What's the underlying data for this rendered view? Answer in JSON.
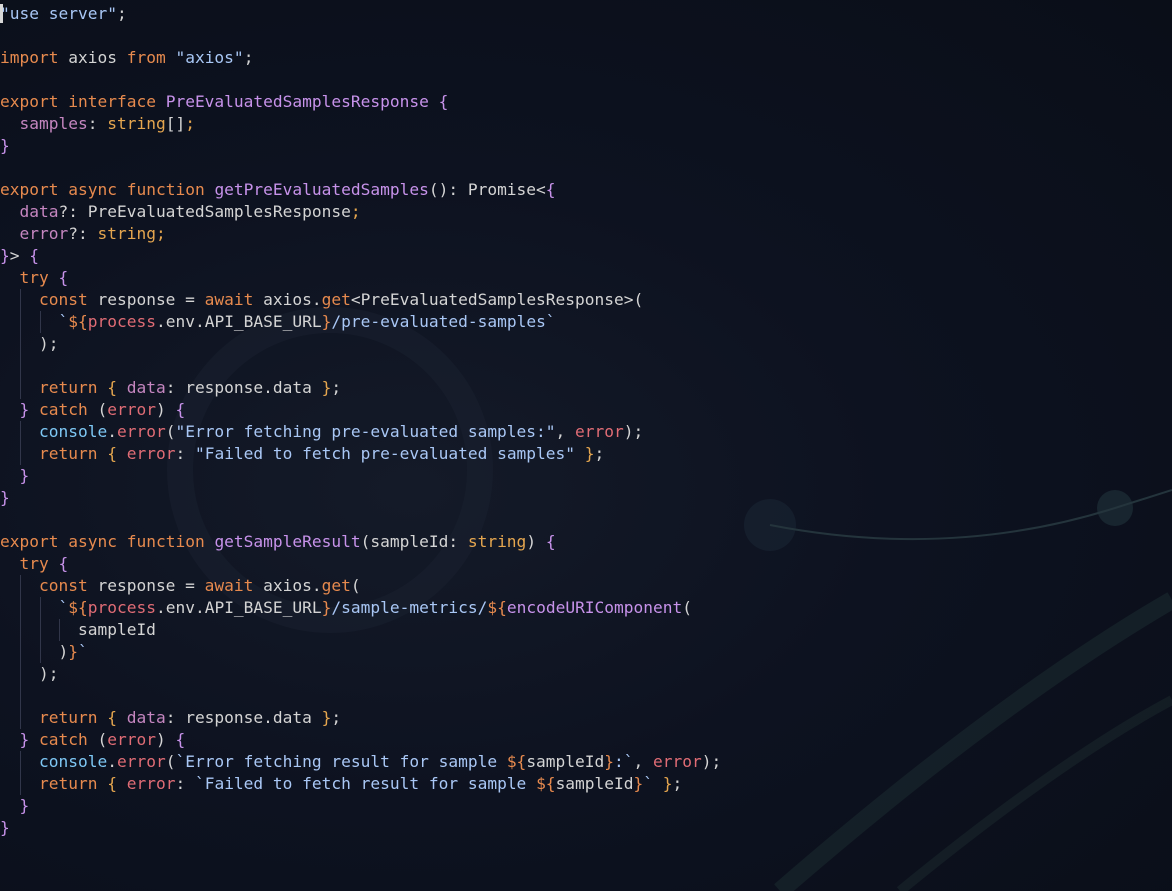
{
  "editor": {
    "language": "typescript",
    "colors": {
      "background": "#0b0f1a",
      "keyword": "#c678dd",
      "control": "#e78a4e",
      "string": "#a9c7f5",
      "type": "#e5a64f",
      "function": "#c792ea",
      "plain": "#cdd6f4"
    },
    "lines": [
      {
        "guides": [],
        "tokens": [
          {
            "c": "str",
            "t": "\"use server\""
          },
          {
            "c": "punc",
            "t": ";"
          }
        ]
      },
      {
        "guides": [],
        "tokens": []
      },
      {
        "guides": [],
        "tokens": [
          {
            "c": "kw",
            "t": "import"
          },
          {
            "c": "punc",
            "t": " axios "
          },
          {
            "c": "kw",
            "t": "from"
          },
          {
            "c": "punc",
            "t": " "
          },
          {
            "c": "str",
            "t": "\"axios\""
          },
          {
            "c": "punc",
            "t": ";"
          }
        ]
      },
      {
        "guides": [],
        "tokens": []
      },
      {
        "guides": [],
        "tokens": [
          {
            "c": "kw",
            "t": "export"
          },
          {
            "c": "punc",
            "t": " "
          },
          {
            "c": "kw",
            "t": "interface"
          },
          {
            "c": "punc",
            "t": " "
          },
          {
            "c": "fn",
            "t": "PreEvaluatedSamplesResponse"
          },
          {
            "c": "punc",
            "t": " "
          },
          {
            "c": "fn",
            "t": "{"
          }
        ]
      },
      {
        "guides": [],
        "tokens": [
          {
            "c": "punc",
            "t": "  "
          },
          {
            "c": "prop",
            "t": "samples"
          },
          {
            "c": "punc",
            "t": ": "
          },
          {
            "c": "ty",
            "t": "string"
          },
          {
            "c": "punc",
            "t": "[]"
          },
          {
            "c": "ty",
            "t": ";"
          }
        ]
      },
      {
        "guides": [],
        "tokens": [
          {
            "c": "fn",
            "t": "}"
          }
        ]
      },
      {
        "guides": [],
        "tokens": []
      },
      {
        "guides": [],
        "tokens": [
          {
            "c": "kw",
            "t": "export"
          },
          {
            "c": "punc",
            "t": " "
          },
          {
            "c": "kw",
            "t": "async"
          },
          {
            "c": "punc",
            "t": " "
          },
          {
            "c": "kw",
            "t": "function"
          },
          {
            "c": "punc",
            "t": " "
          },
          {
            "c": "fn",
            "t": "getPreEvaluatedSamples"
          },
          {
            "c": "punc",
            "t": "(): Promise<"
          },
          {
            "c": "fn",
            "t": "{"
          }
        ]
      },
      {
        "guides": [],
        "tokens": [
          {
            "c": "punc",
            "t": "  "
          },
          {
            "c": "prop",
            "t": "data"
          },
          {
            "c": "punc",
            "t": "?: PreEvaluatedSamplesResponse"
          },
          {
            "c": "ty",
            "t": ";"
          }
        ]
      },
      {
        "guides": [],
        "tokens": [
          {
            "c": "punc",
            "t": "  "
          },
          {
            "c": "prop",
            "t": "error"
          },
          {
            "c": "punc",
            "t": "?: "
          },
          {
            "c": "ty",
            "t": "string"
          },
          {
            "c": "ty",
            "t": ";"
          }
        ]
      },
      {
        "guides": [],
        "tokens": [
          {
            "c": "fn",
            "t": "}"
          },
          {
            "c": "punc",
            "t": "> "
          },
          {
            "c": "fn",
            "t": "{"
          }
        ]
      },
      {
        "guides": [],
        "tokens": [
          {
            "c": "punc",
            "t": "  "
          },
          {
            "c": "kw",
            "t": "try"
          },
          {
            "c": "punc",
            "t": " "
          },
          {
            "c": "fn",
            "t": "{"
          }
        ]
      },
      {
        "guides": [
          2
        ],
        "tokens": [
          {
            "c": "punc",
            "t": "    "
          },
          {
            "c": "kw",
            "t": "const"
          },
          {
            "c": "punc",
            "t": " response = "
          },
          {
            "c": "kw",
            "t": "await"
          },
          {
            "c": "punc",
            "t": " axios."
          },
          {
            "c": "kw",
            "t": "get"
          },
          {
            "c": "punc",
            "t": "<PreEvaluatedSamplesResponse>("
          }
        ]
      },
      {
        "guides": [
          2,
          4
        ],
        "tokens": [
          {
            "c": "punc",
            "t": "      "
          },
          {
            "c": "str",
            "t": "`"
          },
          {
            "c": "kw",
            "t": "${"
          },
          {
            "c": "var",
            "t": "process"
          },
          {
            "c": "punc",
            "t": ".env.API_BASE_URL"
          },
          {
            "c": "kw",
            "t": "}"
          },
          {
            "c": "str",
            "t": "/pre-evaluated-samples`"
          }
        ]
      },
      {
        "guides": [
          2
        ],
        "tokens": [
          {
            "c": "punc",
            "t": "    );"
          }
        ]
      },
      {
        "guides": [
          2
        ],
        "tokens": []
      },
      {
        "guides": [
          2
        ],
        "tokens": [
          {
            "c": "punc",
            "t": "    "
          },
          {
            "c": "kw",
            "t": "return"
          },
          {
            "c": "punc",
            "t": " "
          },
          {
            "c": "ty",
            "t": "{"
          },
          {
            "c": "punc",
            "t": " "
          },
          {
            "c": "prop",
            "t": "data"
          },
          {
            "c": "punc",
            "t": ": response.data "
          },
          {
            "c": "ty",
            "t": "}"
          },
          {
            "c": "punc",
            "t": ";"
          }
        ]
      },
      {
        "guides": [],
        "tokens": [
          {
            "c": "punc",
            "t": "  "
          },
          {
            "c": "fn",
            "t": "}"
          },
          {
            "c": "punc",
            "t": " "
          },
          {
            "c": "kw",
            "t": "catch"
          },
          {
            "c": "punc",
            "t": " ("
          },
          {
            "c": "var",
            "t": "error"
          },
          {
            "c": "punc",
            "t": ") "
          },
          {
            "c": "fn",
            "t": "{"
          }
        ]
      },
      {
        "guides": [
          2
        ],
        "tokens": [
          {
            "c": "punc",
            "t": "    "
          },
          {
            "c": "obj",
            "t": "console"
          },
          {
            "c": "punc",
            "t": "."
          },
          {
            "c": "var",
            "t": "error"
          },
          {
            "c": "punc",
            "t": "("
          },
          {
            "c": "str",
            "t": "\"Error fetching pre-evaluated samples:\""
          },
          {
            "c": "punc",
            "t": ", "
          },
          {
            "c": "var",
            "t": "error"
          },
          {
            "c": "punc",
            "t": ");"
          }
        ]
      },
      {
        "guides": [
          2
        ],
        "tokens": [
          {
            "c": "punc",
            "t": "    "
          },
          {
            "c": "kw",
            "t": "return"
          },
          {
            "c": "punc",
            "t": " "
          },
          {
            "c": "ty",
            "t": "{"
          },
          {
            "c": "punc",
            "t": " "
          },
          {
            "c": "var",
            "t": "error"
          },
          {
            "c": "punc",
            "t": ": "
          },
          {
            "c": "str",
            "t": "\"Failed to fetch pre-evaluated samples\""
          },
          {
            "c": "punc",
            "t": " "
          },
          {
            "c": "ty",
            "t": "}"
          },
          {
            "c": "punc",
            "t": ";"
          }
        ]
      },
      {
        "guides": [],
        "tokens": [
          {
            "c": "punc",
            "t": "  "
          },
          {
            "c": "fn",
            "t": "}"
          }
        ]
      },
      {
        "guides": [],
        "tokens": [
          {
            "c": "fn",
            "t": "}"
          }
        ]
      },
      {
        "guides": [],
        "tokens": []
      },
      {
        "guides": [],
        "tokens": [
          {
            "c": "kw",
            "t": "export"
          },
          {
            "c": "punc",
            "t": " "
          },
          {
            "c": "kw",
            "t": "async"
          },
          {
            "c": "punc",
            "t": " "
          },
          {
            "c": "kw",
            "t": "function"
          },
          {
            "c": "punc",
            "t": " "
          },
          {
            "c": "fn",
            "t": "getSampleResult"
          },
          {
            "c": "punc",
            "t": "(sampleId: "
          },
          {
            "c": "ty",
            "t": "string"
          },
          {
            "c": "punc",
            "t": ") "
          },
          {
            "c": "fn",
            "t": "{"
          }
        ]
      },
      {
        "guides": [],
        "tokens": [
          {
            "c": "punc",
            "t": "  "
          },
          {
            "c": "kw",
            "t": "try"
          },
          {
            "c": "punc",
            "t": " "
          },
          {
            "c": "fn",
            "t": "{"
          }
        ]
      },
      {
        "guides": [
          2
        ],
        "tokens": [
          {
            "c": "punc",
            "t": "    "
          },
          {
            "c": "kw",
            "t": "const"
          },
          {
            "c": "punc",
            "t": " response = "
          },
          {
            "c": "kw",
            "t": "await"
          },
          {
            "c": "punc",
            "t": " axios."
          },
          {
            "c": "kw",
            "t": "get"
          },
          {
            "c": "punc",
            "t": "("
          }
        ]
      },
      {
        "guides": [
          2,
          4
        ],
        "tokens": [
          {
            "c": "punc",
            "t": "      "
          },
          {
            "c": "str",
            "t": "`"
          },
          {
            "c": "kw",
            "t": "${"
          },
          {
            "c": "var",
            "t": "process"
          },
          {
            "c": "punc",
            "t": ".env.API_BASE_URL"
          },
          {
            "c": "kw",
            "t": "}"
          },
          {
            "c": "str",
            "t": "/sample-metrics/"
          },
          {
            "c": "kw",
            "t": "${"
          },
          {
            "c": "fn",
            "t": "encodeURIComponent"
          },
          {
            "c": "punc",
            "t": "("
          }
        ]
      },
      {
        "guides": [
          2,
          4,
          6
        ],
        "tokens": [
          {
            "c": "punc",
            "t": "        sampleId"
          }
        ]
      },
      {
        "guides": [
          2,
          4
        ],
        "tokens": [
          {
            "c": "punc",
            "t": "      )"
          },
          {
            "c": "kw",
            "t": "}"
          },
          {
            "c": "str",
            "t": "`"
          }
        ]
      },
      {
        "guides": [
          2
        ],
        "tokens": [
          {
            "c": "punc",
            "t": "    );"
          }
        ]
      },
      {
        "guides": [
          2
        ],
        "tokens": []
      },
      {
        "guides": [
          2
        ],
        "tokens": [
          {
            "c": "punc",
            "t": "    "
          },
          {
            "c": "kw",
            "t": "return"
          },
          {
            "c": "punc",
            "t": " "
          },
          {
            "c": "ty",
            "t": "{"
          },
          {
            "c": "punc",
            "t": " "
          },
          {
            "c": "prop",
            "t": "data"
          },
          {
            "c": "punc",
            "t": ": response.data "
          },
          {
            "c": "ty",
            "t": "}"
          },
          {
            "c": "punc",
            "t": ";"
          }
        ]
      },
      {
        "guides": [],
        "tokens": [
          {
            "c": "punc",
            "t": "  "
          },
          {
            "c": "fn",
            "t": "}"
          },
          {
            "c": "punc",
            "t": " "
          },
          {
            "c": "kw",
            "t": "catch"
          },
          {
            "c": "punc",
            "t": " ("
          },
          {
            "c": "var",
            "t": "error"
          },
          {
            "c": "punc",
            "t": ") "
          },
          {
            "c": "fn",
            "t": "{"
          }
        ]
      },
      {
        "guides": [
          2
        ],
        "tokens": [
          {
            "c": "punc",
            "t": "    "
          },
          {
            "c": "obj",
            "t": "console"
          },
          {
            "c": "punc",
            "t": "."
          },
          {
            "c": "var",
            "t": "error"
          },
          {
            "c": "punc",
            "t": "("
          },
          {
            "c": "str",
            "t": "`Error fetching result for sample "
          },
          {
            "c": "kw",
            "t": "${"
          },
          {
            "c": "punc",
            "t": "sampleId"
          },
          {
            "c": "kw",
            "t": "}"
          },
          {
            "c": "str",
            "t": ":`"
          },
          {
            "c": "punc",
            "t": ", "
          },
          {
            "c": "var",
            "t": "error"
          },
          {
            "c": "punc",
            "t": ");"
          }
        ]
      },
      {
        "guides": [
          2
        ],
        "tokens": [
          {
            "c": "punc",
            "t": "    "
          },
          {
            "c": "kw",
            "t": "return"
          },
          {
            "c": "punc",
            "t": " "
          },
          {
            "c": "ty",
            "t": "{"
          },
          {
            "c": "punc",
            "t": " "
          },
          {
            "c": "var",
            "t": "error"
          },
          {
            "c": "punc",
            "t": ": "
          },
          {
            "c": "str",
            "t": "`Failed to fetch result for sample "
          },
          {
            "c": "kw",
            "t": "${"
          },
          {
            "c": "punc",
            "t": "sampleId"
          },
          {
            "c": "kw",
            "t": "}"
          },
          {
            "c": "str",
            "t": "`"
          },
          {
            "c": "punc",
            "t": " "
          },
          {
            "c": "ty",
            "t": "}"
          },
          {
            "c": "punc",
            "t": ";"
          }
        ]
      },
      {
        "guides": [],
        "tokens": [
          {
            "c": "punc",
            "t": "  "
          },
          {
            "c": "fn",
            "t": "}"
          }
        ]
      },
      {
        "guides": [],
        "tokens": [
          {
            "c": "fn",
            "t": "}"
          }
        ]
      }
    ]
  }
}
